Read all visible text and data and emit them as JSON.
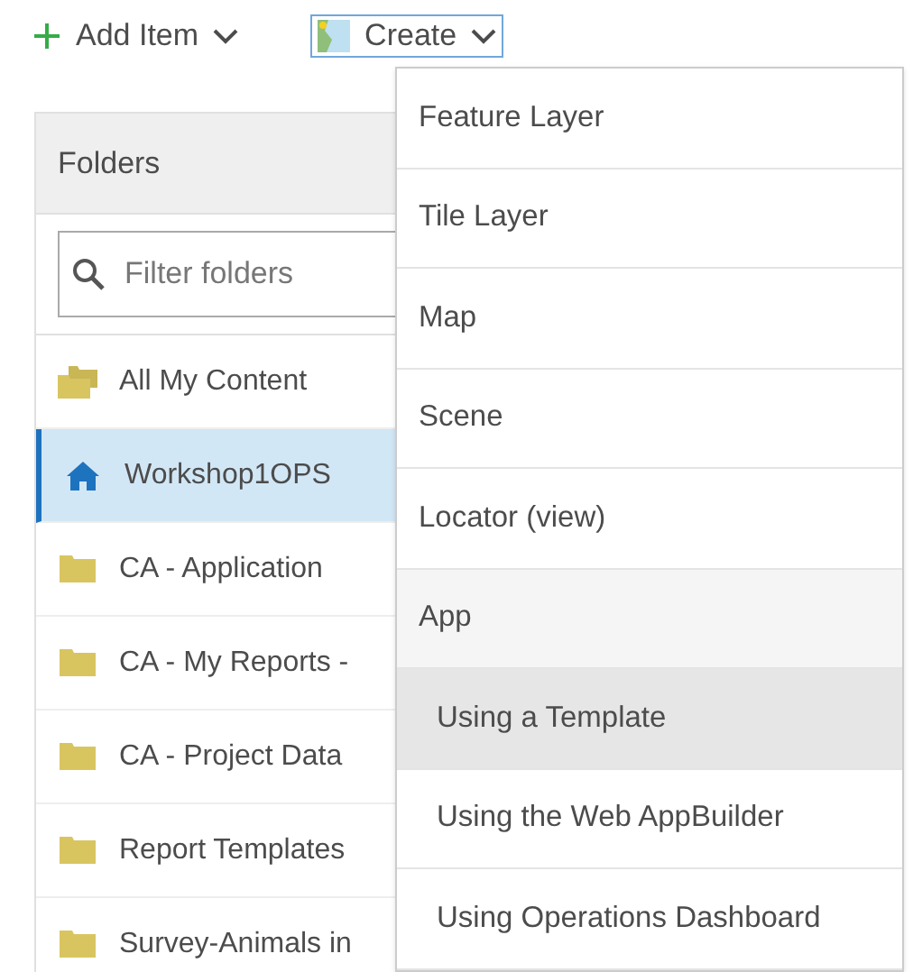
{
  "toolbar": {
    "add_item": "Add Item",
    "create": "Create"
  },
  "folders": {
    "title": "Folders",
    "filter": {
      "placeholder": "Filter folders"
    },
    "items": [
      {
        "label": "All My Content",
        "kind": "all",
        "selected": false
      },
      {
        "label": "Workshop1OPS",
        "kind": "home",
        "selected": true
      },
      {
        "label": "CA - Application",
        "kind": "folder",
        "selected": false
      },
      {
        "label": "CA - My Reports -",
        "kind": "folder",
        "selected": false
      },
      {
        "label": "CA - Project Data",
        "kind": "folder",
        "selected": false
      },
      {
        "label": "Report Templates",
        "kind": "folder",
        "selected": false
      },
      {
        "label": "Survey-Animals in",
        "kind": "folder",
        "selected": false
      }
    ]
  },
  "create_menu": {
    "items": [
      {
        "label": "Feature Layer",
        "kind": "item",
        "highlighted": false
      },
      {
        "label": "Tile Layer",
        "kind": "item",
        "highlighted": false
      },
      {
        "label": "Map",
        "kind": "item",
        "highlighted": false
      },
      {
        "label": "Scene",
        "kind": "item",
        "highlighted": false
      },
      {
        "label": "Locator (view)",
        "kind": "item",
        "highlighted": false
      },
      {
        "label": "App",
        "kind": "group",
        "highlighted": false
      },
      {
        "label": "Using a Template",
        "kind": "subitem",
        "highlighted": true
      },
      {
        "label": "Using the Web AppBuilder",
        "kind": "subitem",
        "highlighted": false
      },
      {
        "label": "Using Operations Dashboard",
        "kind": "subitem",
        "highlighted": false
      }
    ]
  }
}
